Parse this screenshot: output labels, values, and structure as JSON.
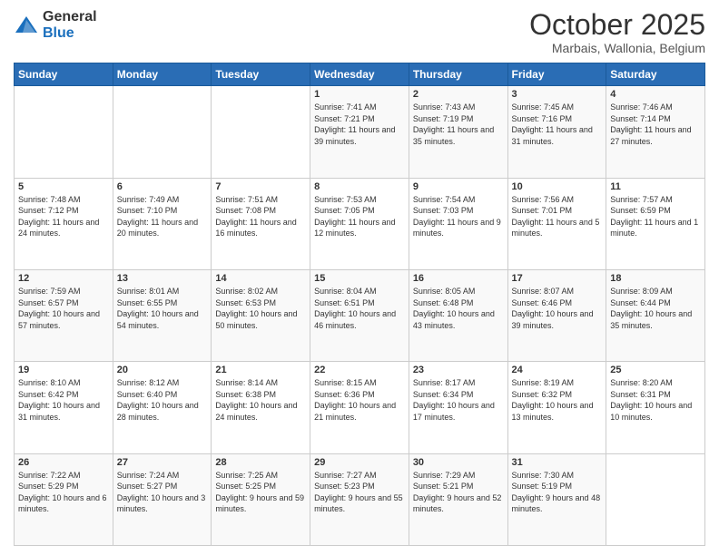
{
  "header": {
    "logo_general": "General",
    "logo_blue": "Blue",
    "month": "October 2025",
    "location": "Marbais, Wallonia, Belgium"
  },
  "weekdays": [
    "Sunday",
    "Monday",
    "Tuesday",
    "Wednesday",
    "Thursday",
    "Friday",
    "Saturday"
  ],
  "weeks": [
    [
      {
        "day": "",
        "info": ""
      },
      {
        "day": "",
        "info": ""
      },
      {
        "day": "",
        "info": ""
      },
      {
        "day": "1",
        "info": "Sunrise: 7:41 AM\nSunset: 7:21 PM\nDaylight: 11 hours\nand 39 minutes."
      },
      {
        "day": "2",
        "info": "Sunrise: 7:43 AM\nSunset: 7:19 PM\nDaylight: 11 hours\nand 35 minutes."
      },
      {
        "day": "3",
        "info": "Sunrise: 7:45 AM\nSunset: 7:16 PM\nDaylight: 11 hours\nand 31 minutes."
      },
      {
        "day": "4",
        "info": "Sunrise: 7:46 AM\nSunset: 7:14 PM\nDaylight: 11 hours\nand 27 minutes."
      }
    ],
    [
      {
        "day": "5",
        "info": "Sunrise: 7:48 AM\nSunset: 7:12 PM\nDaylight: 11 hours\nand 24 minutes."
      },
      {
        "day": "6",
        "info": "Sunrise: 7:49 AM\nSunset: 7:10 PM\nDaylight: 11 hours\nand 20 minutes."
      },
      {
        "day": "7",
        "info": "Sunrise: 7:51 AM\nSunset: 7:08 PM\nDaylight: 11 hours\nand 16 minutes."
      },
      {
        "day": "8",
        "info": "Sunrise: 7:53 AM\nSunset: 7:05 PM\nDaylight: 11 hours\nand 12 minutes."
      },
      {
        "day": "9",
        "info": "Sunrise: 7:54 AM\nSunset: 7:03 PM\nDaylight: 11 hours\nand 9 minutes."
      },
      {
        "day": "10",
        "info": "Sunrise: 7:56 AM\nSunset: 7:01 PM\nDaylight: 11 hours\nand 5 minutes."
      },
      {
        "day": "11",
        "info": "Sunrise: 7:57 AM\nSunset: 6:59 PM\nDaylight: 11 hours\nand 1 minute."
      }
    ],
    [
      {
        "day": "12",
        "info": "Sunrise: 7:59 AM\nSunset: 6:57 PM\nDaylight: 10 hours\nand 57 minutes."
      },
      {
        "day": "13",
        "info": "Sunrise: 8:01 AM\nSunset: 6:55 PM\nDaylight: 10 hours\nand 54 minutes."
      },
      {
        "day": "14",
        "info": "Sunrise: 8:02 AM\nSunset: 6:53 PM\nDaylight: 10 hours\nand 50 minutes."
      },
      {
        "day": "15",
        "info": "Sunrise: 8:04 AM\nSunset: 6:51 PM\nDaylight: 10 hours\nand 46 minutes."
      },
      {
        "day": "16",
        "info": "Sunrise: 8:05 AM\nSunset: 6:48 PM\nDaylight: 10 hours\nand 43 minutes."
      },
      {
        "day": "17",
        "info": "Sunrise: 8:07 AM\nSunset: 6:46 PM\nDaylight: 10 hours\nand 39 minutes."
      },
      {
        "day": "18",
        "info": "Sunrise: 8:09 AM\nSunset: 6:44 PM\nDaylight: 10 hours\nand 35 minutes."
      }
    ],
    [
      {
        "day": "19",
        "info": "Sunrise: 8:10 AM\nSunset: 6:42 PM\nDaylight: 10 hours\nand 31 minutes."
      },
      {
        "day": "20",
        "info": "Sunrise: 8:12 AM\nSunset: 6:40 PM\nDaylight: 10 hours\nand 28 minutes."
      },
      {
        "day": "21",
        "info": "Sunrise: 8:14 AM\nSunset: 6:38 PM\nDaylight: 10 hours\nand 24 minutes."
      },
      {
        "day": "22",
        "info": "Sunrise: 8:15 AM\nSunset: 6:36 PM\nDaylight: 10 hours\nand 21 minutes."
      },
      {
        "day": "23",
        "info": "Sunrise: 8:17 AM\nSunset: 6:34 PM\nDaylight: 10 hours\nand 17 minutes."
      },
      {
        "day": "24",
        "info": "Sunrise: 8:19 AM\nSunset: 6:32 PM\nDaylight: 10 hours\nand 13 minutes."
      },
      {
        "day": "25",
        "info": "Sunrise: 8:20 AM\nSunset: 6:31 PM\nDaylight: 10 hours\nand 10 minutes."
      }
    ],
    [
      {
        "day": "26",
        "info": "Sunrise: 7:22 AM\nSunset: 5:29 PM\nDaylight: 10 hours\nand 6 minutes."
      },
      {
        "day": "27",
        "info": "Sunrise: 7:24 AM\nSunset: 5:27 PM\nDaylight: 10 hours\nand 3 minutes."
      },
      {
        "day": "28",
        "info": "Sunrise: 7:25 AM\nSunset: 5:25 PM\nDaylight: 9 hours\nand 59 minutes."
      },
      {
        "day": "29",
        "info": "Sunrise: 7:27 AM\nSunset: 5:23 PM\nDaylight: 9 hours\nand 55 minutes."
      },
      {
        "day": "30",
        "info": "Sunrise: 7:29 AM\nSunset: 5:21 PM\nDaylight: 9 hours\nand 52 minutes."
      },
      {
        "day": "31",
        "info": "Sunrise: 7:30 AM\nSunset: 5:19 PM\nDaylight: 9 hours\nand 48 minutes."
      },
      {
        "day": "",
        "info": ""
      }
    ]
  ]
}
